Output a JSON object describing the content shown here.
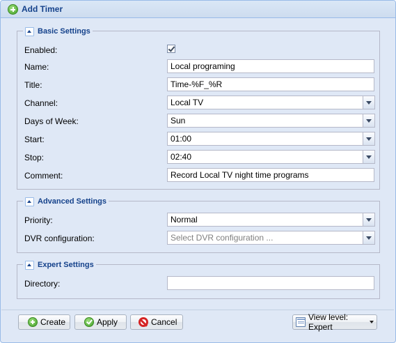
{
  "window": {
    "title": "Add Timer"
  },
  "basic": {
    "legend": "Basic Settings",
    "enabled": {
      "label": "Enabled:",
      "checked": true
    },
    "name": {
      "label": "Name:",
      "value": "Local programing"
    },
    "title": {
      "label": "Title:",
      "value": "Time-%F_%R"
    },
    "channel": {
      "label": "Channel:",
      "value": "Local TV"
    },
    "days": {
      "label": "Days of Week:",
      "value": "Sun"
    },
    "start": {
      "label": "Start:",
      "value": "01:00"
    },
    "stop": {
      "label": "Stop:",
      "value": "02:40"
    },
    "comment": {
      "label": "Comment:",
      "value": "Record Local TV night time programs"
    }
  },
  "advanced": {
    "legend": "Advanced Settings",
    "priority": {
      "label": "Priority:",
      "value": "Normal"
    },
    "dvr": {
      "label": "DVR configuration:",
      "placeholder": "Select DVR configuration ..."
    }
  },
  "expert": {
    "legend": "Expert Settings",
    "directory": {
      "label": "Directory:",
      "value": ""
    }
  },
  "buttons": {
    "create": "Create",
    "apply": "Apply",
    "cancel": "Cancel",
    "view_level": "View level: Expert"
  }
}
